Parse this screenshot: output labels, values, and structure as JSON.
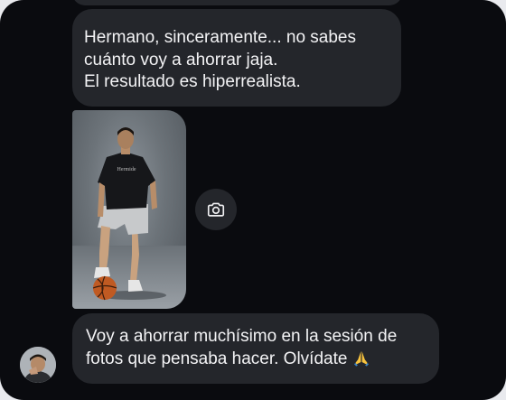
{
  "chat": {
    "messages": [
      {
        "lines": [
          "Hermano, sinceramente... no sabes",
          "cuánto voy a ahorrar jaja.",
          "El resultado es hiperrealista."
        ]
      },
      {
        "lines": [
          "Voy a ahorrar muchísimo en la sesión de",
          "fotos que pensaba hacer. Olvídate"
        ],
        "trailing_emoji": "folded-hands-emoji"
      }
    ],
    "photo_shirt_text": "Hermide",
    "photo_action_icon": "camera-icon"
  },
  "colors": {
    "background": "#0a0b0f",
    "bubble": "#24262b",
    "text": "#f3f3f5"
  }
}
